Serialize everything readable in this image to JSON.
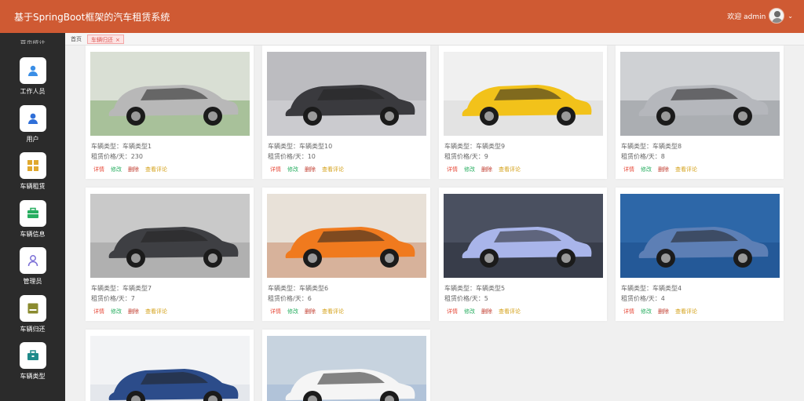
{
  "header": {
    "title": "基于SpringBoot框架的汽车租赁系统",
    "welcome": "欢迎 admin",
    "bg_color": "#cf5a33"
  },
  "sidebar": {
    "cut_label": "首页统计",
    "items": [
      {
        "label": "工作人员",
        "icon": "person-icon",
        "color": "#3a8ee6"
      },
      {
        "label": "用户",
        "icon": "user-icon",
        "color": "#2f6fd8"
      },
      {
        "label": "车辆租赁",
        "icon": "grid-icon",
        "color": "#e0a82e"
      },
      {
        "label": "车辆信息",
        "icon": "briefcase-icon",
        "color": "#27ae60"
      },
      {
        "label": "管理员",
        "icon": "admin-icon",
        "color": "#7b6fd6"
      },
      {
        "label": "车辆归还",
        "icon": "return-icon",
        "color": "#8a8a2e"
      },
      {
        "label": "车辆类型",
        "icon": "toolbox-icon",
        "color": "#1f8a8a"
      }
    ]
  },
  "tabs": {
    "home": "首页",
    "active": "车辆归还",
    "close": "×"
  },
  "labels": {
    "type_prefix": "车辆类型：",
    "price_prefix": "租赁价格/天：",
    "detail": "详情",
    "edit": "修改",
    "delete": "删除",
    "review": "查看评论"
  },
  "cars": [
    {
      "type": "车辆类型1",
      "price": "230",
      "car_color": "#b8b8b8",
      "scene": "#7fa86a",
      "scene2": "#d9dfd4"
    },
    {
      "type": "车辆类型10",
      "price": "10",
      "car_color": "#3a3a3e",
      "scene": "#d7d7da",
      "scene2": "#bcbcc0"
    },
    {
      "type": "车辆类型9",
      "price": "9",
      "car_color": "#f2c21a",
      "scene": "#d8d8d8",
      "scene2": "#f0f0f0"
    },
    {
      "type": "车辆类型8",
      "price": "8",
      "car_color": "#b5b7bc",
      "scene": "#8e9196",
      "scene2": "#cfd1d4"
    },
    {
      "type": "车辆类型7",
      "price": "7",
      "car_color": "#3e3f43",
      "scene": "#9a9a9a",
      "scene2": "#c9c9c9"
    },
    {
      "type": "车辆类型6",
      "price": "6",
      "car_color": "#f07a1e",
      "scene": "#c98d6a",
      "scene2": "#e8e1d8"
    },
    {
      "type": "车辆类型5",
      "price": "5",
      "car_color": "#a9b5ea",
      "scene": "#2a2d38",
      "scene2": "#4a5060"
    },
    {
      "type": "车辆类型4",
      "price": "4",
      "car_color": "#5d7fb5",
      "scene": "#1d4f8a",
      "scene2": "#2d67a8"
    },
    {
      "car_color": "#2c4c8a",
      "scene": "#d9dde3",
      "scene2": "#f2f3f5"
    },
    {
      "car_color": "#f5f5f5",
      "scene": "#9fb7d3",
      "scene2": "#c7d3df"
    }
  ]
}
